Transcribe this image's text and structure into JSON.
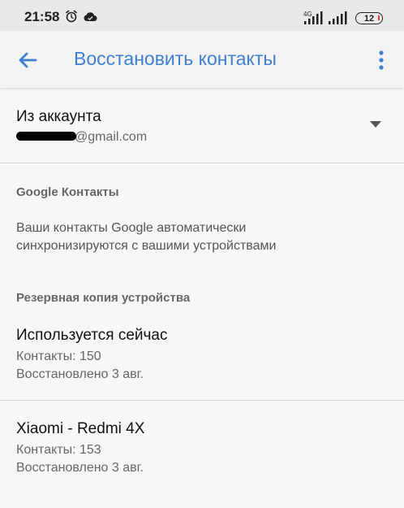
{
  "status_bar": {
    "time": "21:58",
    "network_type": "4G",
    "battery_level": "12",
    "icons": [
      "alarm-icon",
      "cloud-icon",
      "signal-icon",
      "signal-icon",
      "battery-icon"
    ]
  },
  "toolbar": {
    "title": "Восстановить контакты",
    "back_icon": "arrow-left-icon",
    "more_icon": "more-vert-icon",
    "accent_color": "#3f7fd0"
  },
  "account": {
    "label": "Из аккаунта",
    "email_suffix": "@gmail.com",
    "dropdown_icon": "triangle-down-icon"
  },
  "google_contacts": {
    "header": "Google Контакты",
    "line1": "Ваши контакты Google автоматически",
    "line2": "синхронизируются с вашими устройствами"
  },
  "device_backup": {
    "header": "Резервная копия устройства",
    "items": [
      {
        "title": "Используется сейчас",
        "contacts": "Контакты: 150",
        "restored": "Восстановлено 3 авг."
      },
      {
        "title": "Xiaomi - Redmi 4X",
        "contacts": "Контакты: 153",
        "restored": "Восстановлено 3 авг."
      }
    ]
  }
}
